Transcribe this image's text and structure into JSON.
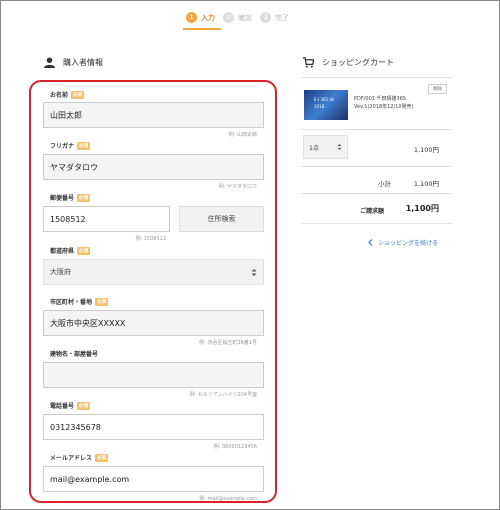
{
  "steps": [
    {
      "num": "1",
      "label": "入力"
    },
    {
      "num": "2",
      "label": "確認"
    },
    {
      "num": "3",
      "label": "完了"
    }
  ],
  "buyer_section": {
    "title": "購入者情報"
  },
  "cart_section": {
    "title": "ショッピングカート"
  },
  "required_badge": "必須",
  "form": {
    "name": {
      "label": "お名前",
      "value": "山田太郎",
      "hint": "例: 山田太郎"
    },
    "kana": {
      "label": "フリガナ",
      "value": "ヤマダタロウ",
      "hint": "例: ヤマダタロウ"
    },
    "postal": {
      "label": "郵便番号",
      "value": "1508512",
      "hint": "例: 1508512",
      "search_button": "住所検索"
    },
    "prefecture": {
      "label": "都道府県",
      "value": "大阪府"
    },
    "city": {
      "label": "市区町村・番地",
      "value": "大阪市中央区XXXXX",
      "hint": "例: 渋谷区桜丘町26番1号"
    },
    "building": {
      "label": "建物名・部屋番号",
      "value": "",
      "hint": "例: セルリアンハイツ204号室"
    },
    "phone": {
      "label": "電話番号",
      "value": "0312345678",
      "hint": "例: 08000123456"
    },
    "email": {
      "label": "メールアドレス",
      "value": "mail@example.com",
      "hint": "例: mail@example.com"
    }
  },
  "cart": {
    "item": {
      "name": "PDF/001 千田晴雄365 Vev.1(2018年12/10発売)",
      "delete_label": "削除",
      "thumb_line1": "E-I  365 Ve",
      "thumb_line2": "2018..."
    },
    "quantity": "1点",
    "line_price": "1,100円",
    "subtotal_label": "小計",
    "subtotal_value": "1,100円",
    "total_label": "ご請求額",
    "total_value": "1,100円",
    "continue_label": "ショッピングを続ける"
  }
}
